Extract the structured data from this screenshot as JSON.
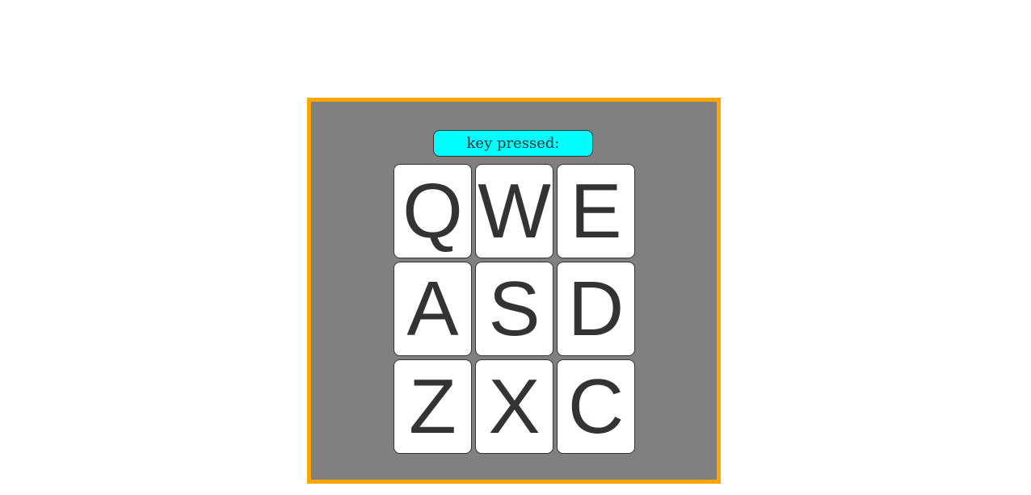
{
  "display": {
    "text": "key pressed:"
  },
  "pads": [
    {
      "key": "Q"
    },
    {
      "key": "W"
    },
    {
      "key": "E"
    },
    {
      "key": "A"
    },
    {
      "key": "S"
    },
    {
      "key": "D"
    },
    {
      "key": "Z"
    },
    {
      "key": "X"
    },
    {
      "key": "C"
    }
  ],
  "colors": {
    "frame_border": "#FFA500",
    "frame_background": "#808080",
    "display_background": "#00FFFF",
    "pad_background": "#FFFFFF",
    "text": "#333333"
  }
}
